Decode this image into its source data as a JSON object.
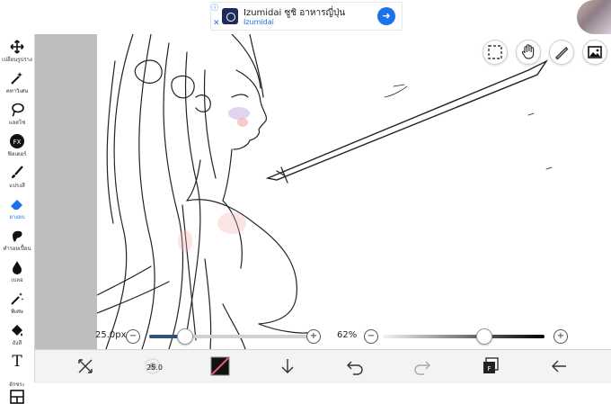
{
  "ad": {
    "title": "Izumidai ซูชิ อาหารญี่ปุ่น",
    "subtitle": "Izumidai",
    "info_icon": "info-icon",
    "close_glyph": "✕"
  },
  "toolbar": {
    "items": [
      {
        "label": "เปลี่ยนรูปร่าง",
        "icon": "move-icon"
      },
      {
        "label": "คทาวิเศษ",
        "icon": "magic-wand-icon"
      },
      {
        "label": "แลสโซ่",
        "icon": "lasso-icon"
      },
      {
        "label": "ฟิลเตอร์",
        "icon": "fx-icon",
        "glyph": "FX"
      },
      {
        "label": "แปรงสี",
        "icon": "brush-icon"
      },
      {
        "label": "ยางลบ",
        "icon": "eraser-icon",
        "active": true
      },
      {
        "label": "ทำรอยเปื้อน",
        "icon": "smudge-icon"
      },
      {
        "label": "เบลอ",
        "icon": "blur-icon"
      },
      {
        "label": "พิเศษ",
        "icon": "special-icon"
      },
      {
        "label": "ถังสี",
        "icon": "bucket-icon"
      },
      {
        "label": "อักขระ",
        "icon": "text-icon",
        "glyph": "T"
      },
      {
        "label": "แบ่งเฟรม",
        "icon": "frame-icon"
      }
    ]
  },
  "canvas_actions": [
    "selection-icon",
    "hand-icon",
    "ruler-icon",
    "image-icon"
  ],
  "sliders": {
    "size_label": "25.0px",
    "size_level": 0.22,
    "opacity_label": "62%",
    "opacity_level": 0.62,
    "minus": "−",
    "plus": "+"
  },
  "bottombar": {
    "brush_size_badge": "25.0",
    "items": [
      "transform-icon",
      "brush-size-icon",
      "color-swatch-icon",
      "download-icon",
      "undo-icon",
      "redo-icon",
      "layers-icon",
      "back-icon"
    ]
  },
  "colors": {
    "accent": "#1a73e8",
    "side_gray": "#bebebe",
    "toolbar_bg": "#ffffff"
  }
}
